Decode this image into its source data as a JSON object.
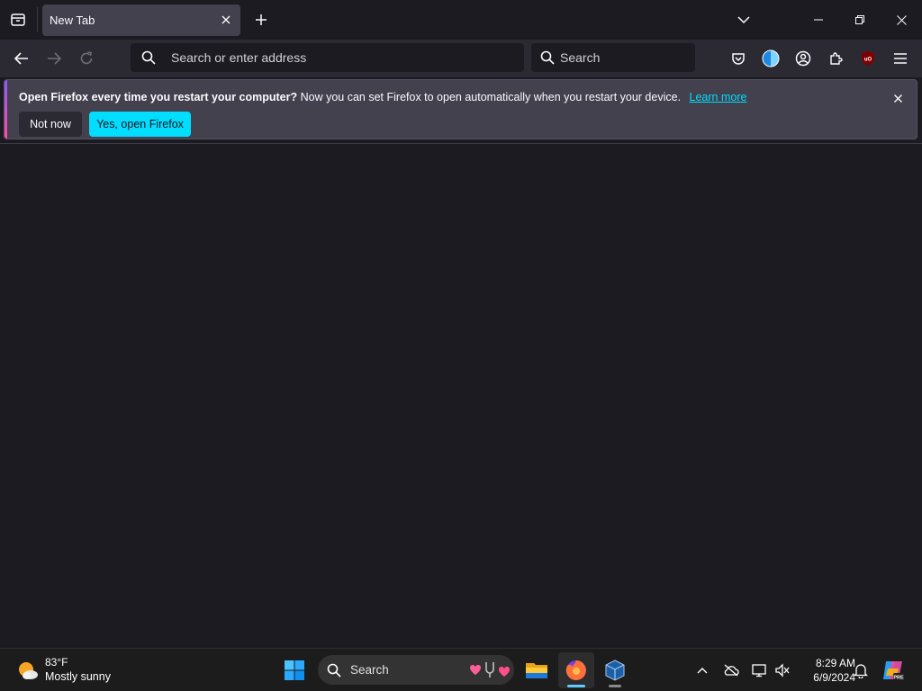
{
  "browser": {
    "tab": {
      "title": "New Tab"
    },
    "urlbar": {
      "placeholder": "Search or enter address"
    },
    "searchbar": {
      "placeholder": "Search"
    },
    "toolbar_icons": [
      "pocket-icon",
      "extension-blue-circle-icon",
      "account-icon",
      "extensions-icon",
      "ublock-origin-icon",
      "menu-icon"
    ]
  },
  "notification": {
    "title": "Open Firefox every time you restart your computer?",
    "message": "Now you can set Firefox to open automatically when you restart your device.",
    "link": "Learn more",
    "secondary_button": "Not now",
    "primary_button": "Yes, open Firefox"
  },
  "taskbar": {
    "weather": {
      "temp": "83°F",
      "desc": "Mostly sunny"
    },
    "search_label": "Search",
    "apps": [
      "start-icon",
      "file-explorer-icon",
      "firefox-icon",
      "virtualbox-icon"
    ],
    "clock": {
      "time": "8:29 AM",
      "date": "6/9/2024"
    }
  },
  "colors": {
    "window_bg": "#1c1b22",
    "toolbar_bg": "#2b2a33",
    "accent": "#00ddff",
    "taskbar_bg": "#1c1c1c"
  }
}
